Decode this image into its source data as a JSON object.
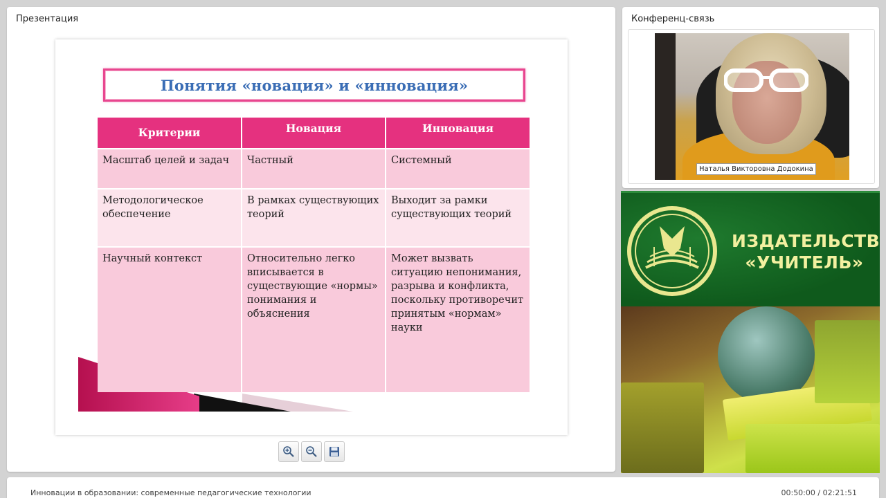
{
  "presentation_panel": {
    "title": "Презентация"
  },
  "slide": {
    "title": "Понятия «новация» и «инновация»",
    "table": {
      "headers": [
        "Критерии",
        "Новация",
        "Инновация"
      ],
      "rows": [
        [
          "Масштаб целей и задач",
          "Частный",
          "Системный"
        ],
        [
          "Методологическое обеспечение",
          "В рамках существующих теорий",
          "Выходит за рамки существующих теорий"
        ],
        [
          "Научный контекст",
          "Относительно легко вписывается в существующие «нормы» понимания и объяснения",
          "Может вызвать ситуацию непонимания, разрыва и конфликта, поскольку противоречит принятым «нормам» науки"
        ]
      ]
    },
    "accent_color": "#e5317f"
  },
  "toolbar": {
    "zoom_in_icon": "zoom-in-icon",
    "zoom_out_icon": "zoom-out-icon",
    "save_icon": "save-icon"
  },
  "conference_panel": {
    "title": "Конференц-связь",
    "participant_name": "Наталья Викторовна Додокина"
  },
  "ad": {
    "line1": "ИЗДАТЕЛЬСТВО",
    "line2": "«УЧИТЕЛЬ»"
  },
  "status_bar": {
    "course_title": "Инновации в образовании: современные педагогические технологии",
    "time": "00:50:00 / 02:21:51"
  }
}
